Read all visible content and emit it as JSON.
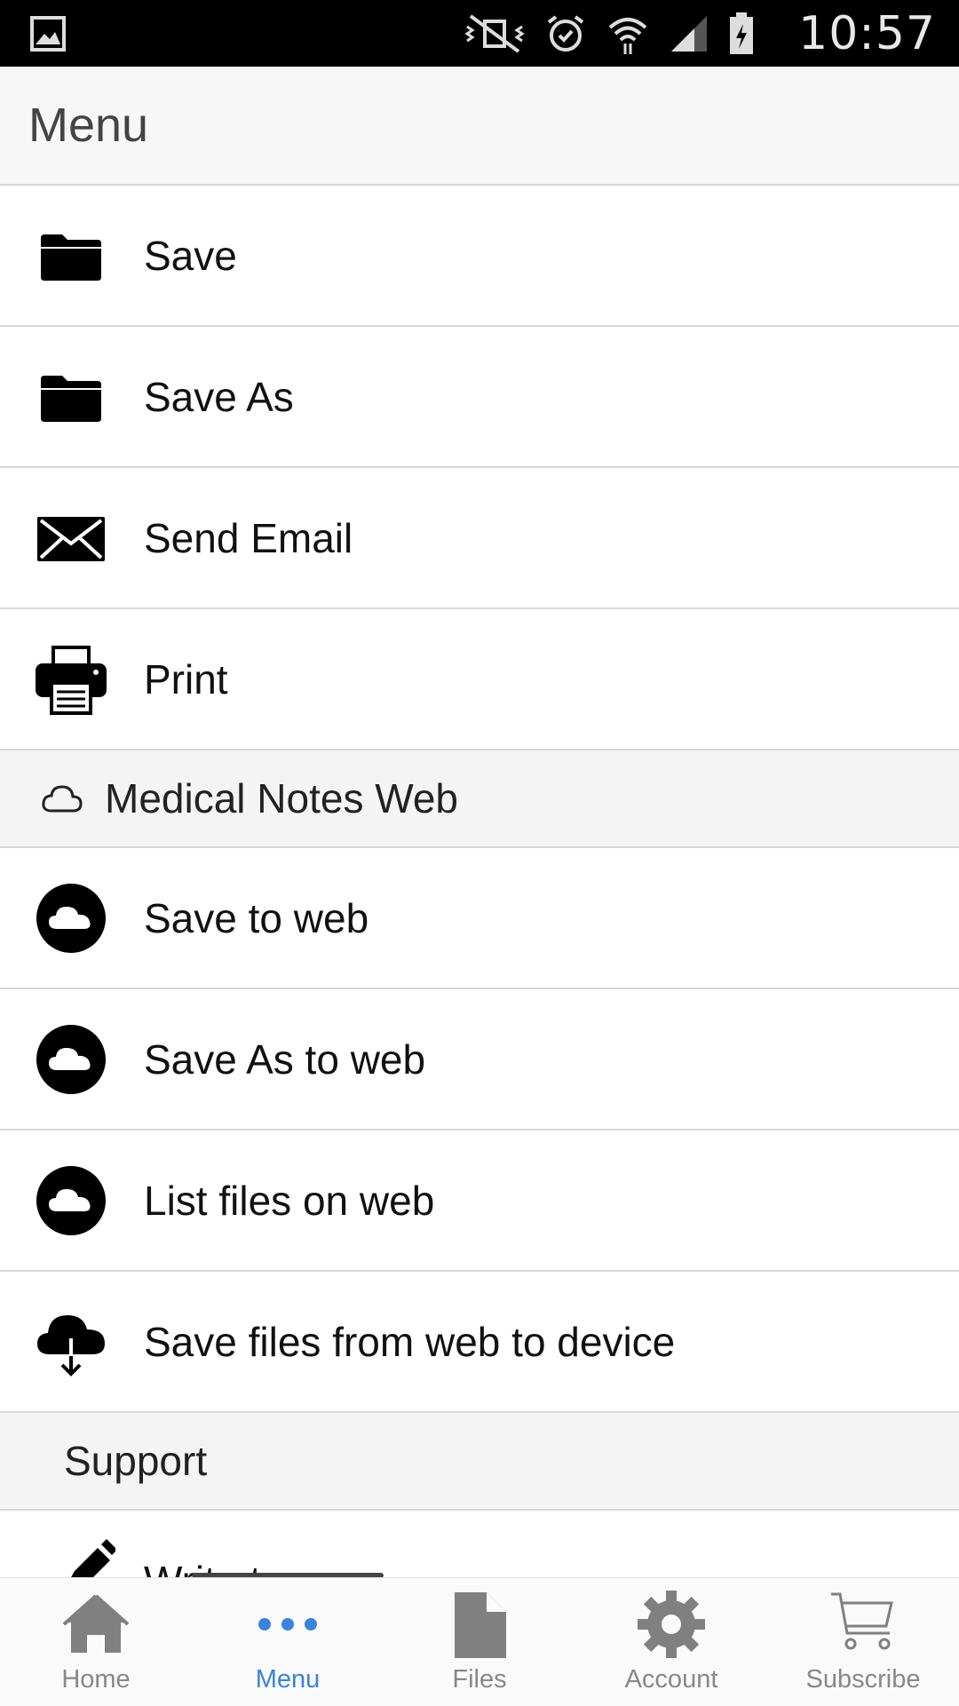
{
  "status_bar": {
    "time": "10:57",
    "icons": [
      "gallery-icon",
      "mute-icon",
      "alarm-icon",
      "wifi-icon",
      "signal-icon",
      "battery-icon"
    ]
  },
  "header": {
    "title": "Menu"
  },
  "menu_items": [
    {
      "label": "Save",
      "icon": "folder-icon"
    },
    {
      "label": "Save As",
      "icon": "folder-icon"
    },
    {
      "label": "Send Email",
      "icon": "envelope-icon"
    },
    {
      "label": "Print",
      "icon": "printer-icon"
    }
  ],
  "web_section": {
    "title": "Medical Notes Web",
    "icon": "cloud-outline-icon",
    "items": [
      {
        "label": "Save to web",
        "icon": "cloud-circle-icon"
      },
      {
        "label": "Save As to web",
        "icon": "cloud-circle-icon"
      },
      {
        "label": "List files on web",
        "icon": "cloud-circle-icon"
      },
      {
        "label": "Save files from web to device",
        "icon": "cloud-download-icon"
      }
    ]
  },
  "support_section": {
    "title": "Support",
    "items": [
      {
        "label": "Write to us",
        "icon": "pencil-icon"
      }
    ]
  },
  "tabs": [
    {
      "label": "Home",
      "icon": "home-icon",
      "active": false
    },
    {
      "label": "Menu",
      "icon": "more-dots-icon",
      "active": true
    },
    {
      "label": "Files",
      "icon": "file-icon",
      "active": false
    },
    {
      "label": "Account",
      "icon": "gear-icon",
      "active": false
    },
    {
      "label": "Subscribe",
      "icon": "cart-icon",
      "active": false
    }
  ],
  "colors": {
    "accent": "#3b82d9",
    "tab_inactive": "#888888",
    "status_bar": "#000000"
  }
}
